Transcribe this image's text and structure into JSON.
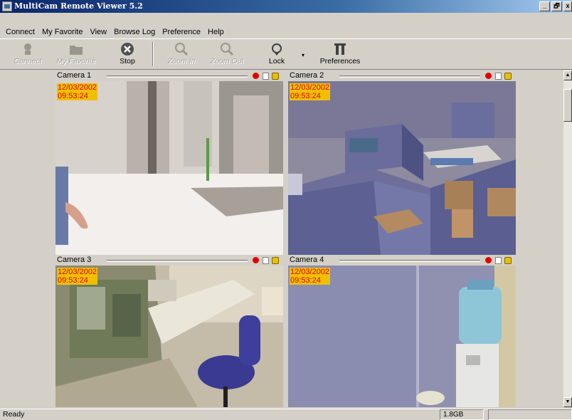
{
  "window": {
    "title": "MultiCam Remote Viewer 5.2",
    "minimize": "_",
    "maximize": "🗗",
    "close": "x"
  },
  "menu": [
    "Connect",
    "My Favorite",
    "View",
    "Browse Log",
    "Preference",
    "Help"
  ],
  "toolbar": {
    "connect": "Connect",
    "favorite": "My Favorite",
    "stop": "Stop",
    "zoom_in": "Zoom In",
    "zoom_out": "Zoom Out",
    "lock": "Lock",
    "preferences": "Preferences"
  },
  "cameras": [
    {
      "label": "Camera 1",
      "date": "12/03/2002",
      "time": "09:53:24"
    },
    {
      "label": "Camera 2",
      "date": "12/03/2002",
      "time": "09:53:24"
    },
    {
      "label": "Camera 3",
      "date": "12/03/2002",
      "time": "09:53:24"
    },
    {
      "label": "Camera 4",
      "date": "12/03/2002",
      "time": "09:53:24"
    }
  ],
  "status": {
    "text": "Ready",
    "disk": "1.8GB"
  },
  "colors": {
    "titlebar": "#0a246a",
    "recording": "#e00000",
    "osd_bg": "#f0c000",
    "osd_text": "#e00000"
  }
}
